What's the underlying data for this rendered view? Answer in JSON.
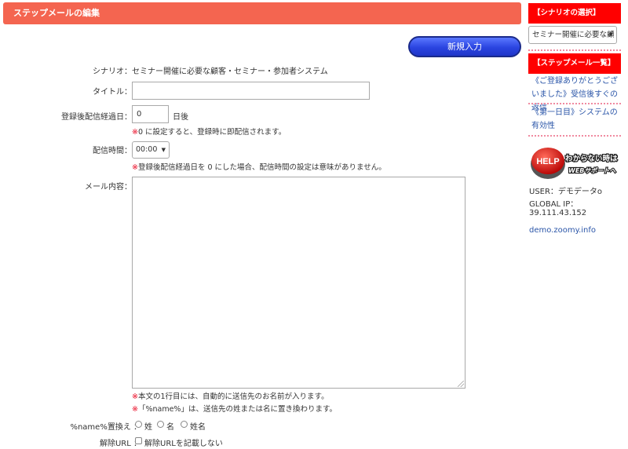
{
  "header": {
    "title": "ステップメールの編集"
  },
  "toolbar": {
    "new_label": "新規入力"
  },
  "form": {
    "scenario": {
      "label": "シナリオ：",
      "value": "セミナー開催に必要な顧客・セミナー・参加者システム"
    },
    "title": {
      "label": "タイトル：",
      "value": ""
    },
    "days": {
      "label": "登録後配信経過日：",
      "value": "0",
      "unit": "日後",
      "note_mark": "※",
      "note_text": "0 に設定すると、登録時に即配信されます。"
    },
    "time": {
      "label": "配信時間：",
      "value": "00:00",
      "note_mark": "※",
      "note_text": "登録後配信経過日を 0 にした場合、配信時間の設定は意味がありません。"
    },
    "body": {
      "label": "メール内容：",
      "value": "",
      "note1_mark": "※",
      "note1_text": "本文の1行目には、自動的に送信先のお名前が入ります。",
      "note2_mark": "※",
      "note2_text": "「%name%」は、送信先の姓または名に置き換わります。"
    },
    "name_replace": {
      "label": "%name%置換え ：",
      "options": [
        "姓",
        "名",
        "姓名"
      ]
    },
    "unsubscribe": {
      "label": "解除URL ：",
      "checkbox_label": "解除URLを記載しない"
    }
  },
  "sidebar": {
    "scenario_heading": "【シナリオの選択】",
    "scenario_select": "セミナー開催に必要な顧",
    "stepmail_heading": "【ステップメール一覧】",
    "stepmail_items": [
      "《ご登録ありがとうございました》受信後すぐの返信",
      "《第一日目》システムの有効性"
    ],
    "help": {
      "badge": "HELP",
      "line1": "わからない時は",
      "line2": "WEBサポートへ"
    },
    "user_line": "USER：デモデータo",
    "ip_label": "GLOBAL IP：",
    "ip_value": "39.111.43.152",
    "domain": "demo.zoomy.info"
  },
  "colors": {
    "header_bg": "#f46550",
    "button_blue": "#2a44e0",
    "sidebar_red": "#ff0000",
    "note_red": "#e8001c",
    "link_blue": "#2a55a8"
  }
}
